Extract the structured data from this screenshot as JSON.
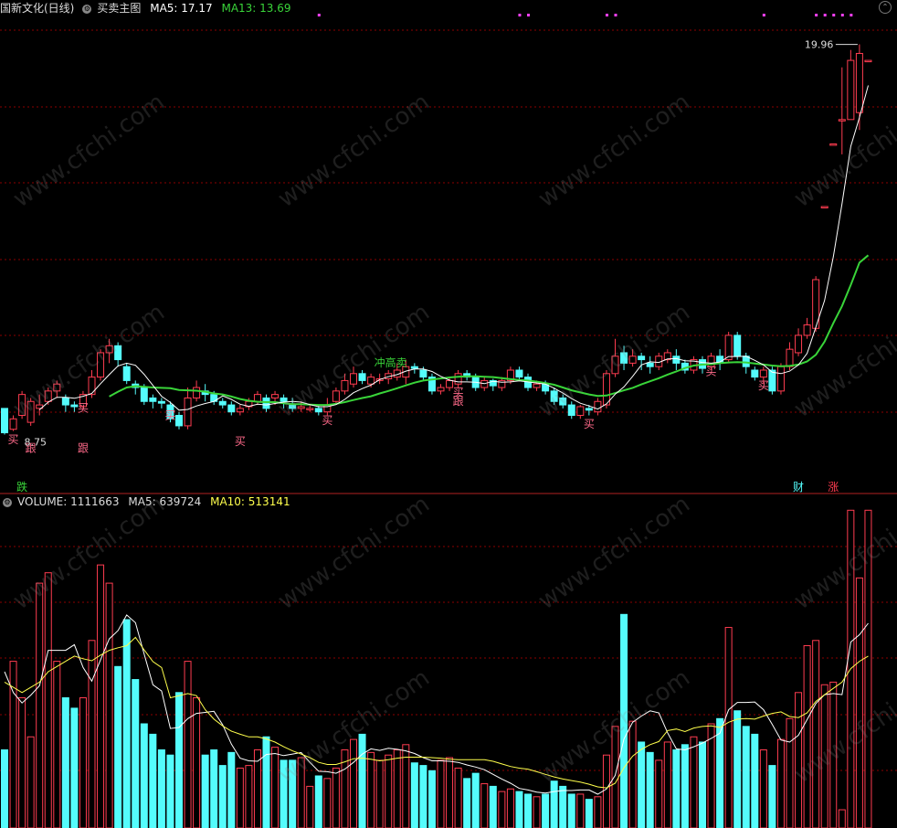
{
  "price_header": {
    "stock_name": "国新文化(日线)",
    "indicator_name": "买卖主图",
    "ma5_label": "MA5: 17.17",
    "ma13_label": "MA13: 13.69"
  },
  "volume_header": {
    "volume_label": "VOLUME: 1111663",
    "ma5_label": "MA5: 639724",
    "ma10_label": "MA10: 513141"
  },
  "watermark": "www.cfchi.com",
  "colors": {
    "up": "#ff3c50",
    "down": "#54fcfc",
    "ma5": "#ffffff",
    "ma13": "#39d439",
    "vol_ma10": "#ffff4c",
    "grid": "#8b0000"
  },
  "chart_data": {
    "type": "candlestick",
    "n": 100,
    "price_axis_range": [
      8.0,
      20.5
    ],
    "annotations": {
      "high_label": "19.96",
      "low_label": "8.75",
      "signals": [
        {
          "i": 1,
          "text": "买",
          "color": "#ff6a8a",
          "price": 8.5
        },
        {
          "i": 3,
          "text": "跟",
          "color": "#ff6a8a",
          "price": 8.25
        },
        {
          "i": 9,
          "text": "买",
          "color": "#ff6a8a",
          "price": 9.4
        },
        {
          "i": 9,
          "text": "跟",
          "color": "#ff6a8a",
          "price": 8.25
        },
        {
          "i": 19,
          "text": "买",
          "color": "#ff6a8a",
          "price": 9.2
        },
        {
          "i": 27,
          "text": "买",
          "color": "#ff6a8a",
          "price": 8.45
        },
        {
          "i": 37,
          "text": "买",
          "color": "#ff6a8a",
          "price": 9.05
        },
        {
          "i": 43,
          "text": "冲高卖",
          "color": "#39d439",
          "price": 10.7
        },
        {
          "i": 52,
          "text": "买",
          "color": "#ff6a8a",
          "price": 9.85
        },
        {
          "i": 52,
          "text": "跟",
          "color": "#ff6a8a",
          "price": 9.6
        },
        {
          "i": 67,
          "text": "买",
          "color": "#ff6a8a",
          "price": 8.95
        },
        {
          "i": 81,
          "text": "买",
          "color": "#ff6a8a",
          "price": 10.45
        },
        {
          "i": 87,
          "text": "买",
          "color": "#ff6a8a",
          "price": 10.05
        }
      ],
      "bottom_badges": [
        {
          "i": 2,
          "text": "跌",
          "color": "#39d439"
        },
        {
          "i": 91,
          "text": "财",
          "color": "#54fcfc"
        },
        {
          "i": 95,
          "text": "涨",
          "color": "#ff3c50"
        }
      ],
      "top_marks": [
        36,
        59,
        60,
        69,
        70,
        87,
        93,
        94,
        95,
        96,
        97
      ]
    },
    "candles": [
      [
        9.5,
        8.8,
        9.3,
        8.75
      ],
      [
        8.9,
        9.2,
        9.3,
        8.85
      ],
      [
        9.3,
        9.9,
        10.0,
        9.2
      ],
      [
        9.1,
        9.7,
        9.8,
        9.0
      ],
      [
        9.5,
        9.6,
        9.9,
        9.3
      ],
      [
        9.7,
        10.0,
        10.1,
        9.6
      ],
      [
        10.0,
        10.2,
        10.3,
        9.8
      ],
      [
        9.8,
        9.6,
        9.9,
        9.4
      ],
      [
        9.6,
        9.55,
        9.7,
        9.4
      ],
      [
        9.55,
        9.9,
        10.0,
        9.5
      ],
      [
        9.9,
        10.4,
        10.6,
        9.8
      ],
      [
        10.4,
        11.1,
        11.2,
        10.3
      ],
      [
        11.1,
        11.3,
        11.5,
        10.8
      ],
      [
        11.3,
        10.9,
        11.4,
        10.7
      ],
      [
        10.7,
        10.3,
        10.8,
        10.2
      ],
      [
        10.2,
        10.1,
        10.3,
        9.9
      ],
      [
        10.1,
        9.7,
        10.2,
        9.6
      ],
      [
        9.8,
        9.7,
        9.9,
        9.5
      ],
      [
        9.7,
        9.65,
        9.8,
        9.5
      ],
      [
        9.6,
        9.2,
        9.7,
        9.1
      ],
      [
        9.3,
        9.0,
        9.4,
        8.9
      ],
      [
        9.0,
        9.8,
        10.1,
        8.9
      ],
      [
        9.8,
        10.1,
        10.3,
        9.7
      ],
      [
        10.0,
        9.9,
        10.2,
        9.7
      ],
      [
        9.9,
        9.7,
        10.0,
        9.6
      ],
      [
        9.7,
        9.6,
        9.8,
        9.5
      ],
      [
        9.6,
        9.4,
        9.7,
        9.3
      ],
      [
        9.4,
        9.5,
        9.6,
        9.3
      ],
      [
        9.55,
        9.7,
        9.8,
        9.45
      ],
      [
        9.7,
        9.9,
        10.0,
        9.6
      ],
      [
        9.8,
        9.5,
        9.9,
        9.4
      ],
      [
        9.8,
        9.9,
        10.0,
        9.6
      ],
      [
        9.8,
        9.7,
        9.9,
        9.5
      ],
      [
        9.6,
        9.5,
        9.8,
        9.4
      ],
      [
        9.5,
        9.55,
        9.7,
        9.4
      ],
      [
        9.5,
        9.5,
        9.6,
        9.4
      ],
      [
        9.5,
        9.4,
        9.6,
        9.3
      ],
      [
        9.4,
        9.6,
        9.8,
        9.3
      ],
      [
        9.7,
        10.0,
        10.1,
        9.6
      ],
      [
        10.0,
        10.3,
        10.5,
        9.9
      ],
      [
        10.2,
        10.5,
        10.7,
        10.1
      ],
      [
        10.5,
        10.3,
        10.6,
        10.2
      ],
      [
        10.2,
        10.4,
        10.5,
        10.1
      ],
      [
        10.3,
        10.35,
        10.5,
        10.2
      ],
      [
        10.35,
        10.5,
        10.6,
        10.2
      ],
      [
        10.4,
        10.6,
        10.8,
        10.3
      ],
      [
        10.4,
        10.7,
        10.9,
        10.2
      ],
      [
        10.7,
        10.65,
        10.8,
        10.5
      ],
      [
        10.6,
        10.4,
        10.7,
        10.3
      ],
      [
        10.4,
        10.0,
        10.5,
        9.9
      ],
      [
        10.0,
        10.1,
        10.2,
        9.9
      ],
      [
        10.1,
        10.3,
        10.4,
        10.0
      ],
      [
        10.2,
        10.5,
        10.6,
        10.1
      ],
      [
        10.5,
        10.4,
        10.6,
        10.3
      ],
      [
        10.4,
        10.1,
        10.5,
        10.0
      ],
      [
        10.1,
        10.3,
        10.4,
        10.0
      ],
      [
        10.3,
        10.15,
        10.35,
        10.0
      ],
      [
        10.1,
        10.3,
        10.4,
        10.0
      ],
      [
        10.3,
        10.6,
        10.7,
        10.2
      ],
      [
        10.6,
        10.4,
        10.7,
        10.3
      ],
      [
        10.4,
        10.1,
        10.5,
        10.0
      ],
      [
        10.1,
        10.2,
        10.3,
        10.0
      ],
      [
        10.2,
        10.0,
        10.3,
        9.9
      ],
      [
        10.0,
        9.7,
        10.1,
        9.6
      ],
      [
        9.8,
        9.6,
        9.9,
        9.5
      ],
      [
        9.6,
        9.3,
        9.7,
        9.2
      ],
      [
        9.3,
        9.55,
        9.6,
        9.2
      ],
      [
        9.5,
        9.45,
        9.6,
        9.3
      ],
      [
        9.4,
        9.7,
        9.8,
        9.3
      ],
      [
        9.6,
        10.5,
        10.6,
        9.5
      ],
      [
        10.5,
        11.0,
        11.5,
        10.4
      ],
      [
        11.1,
        10.8,
        11.3,
        10.6
      ],
      [
        10.8,
        11.0,
        11.2,
        10.7
      ],
      [
        11.0,
        10.9,
        11.1,
        10.6
      ],
      [
        10.8,
        10.7,
        11.0,
        10.5
      ],
      [
        10.7,
        11.0,
        11.1,
        10.6
      ],
      [
        10.9,
        11.1,
        11.2,
        10.8
      ],
      [
        11.0,
        10.8,
        11.2,
        10.6
      ],
      [
        10.8,
        10.6,
        10.9,
        10.5
      ],
      [
        10.6,
        10.9,
        11.0,
        10.5
      ],
      [
        10.9,
        10.65,
        11.0,
        10.5
      ],
      [
        10.7,
        11.0,
        11.1,
        10.6
      ],
      [
        11.0,
        10.8,
        11.2,
        10.6
      ],
      [
        10.9,
        11.6,
        11.7,
        10.8
      ],
      [
        11.6,
        11.0,
        11.7,
        10.9
      ],
      [
        11.0,
        10.7,
        11.1,
        10.5
      ],
      [
        10.6,
        10.4,
        10.7,
        10.3
      ],
      [
        10.4,
        10.6,
        10.7,
        10.2
      ],
      [
        10.6,
        10.0,
        10.7,
        9.9
      ],
      [
        10.0,
        10.7,
        10.8,
        9.9
      ],
      [
        10.7,
        11.2,
        11.4,
        10.6
      ],
      [
        11.1,
        11.6,
        11.8,
        11.0
      ],
      [
        11.6,
        11.9,
        12.1,
        11.5
      ],
      [
        11.8,
        13.2,
        13.3,
        11.7
      ],
      [
        15.3,
        15.3,
        15.3,
        15.3
      ],
      [
        17.1,
        17.1,
        17.1,
        17.1
      ],
      [
        17.8,
        17.8,
        19.3,
        16.8
      ],
      [
        17.8,
        19.5,
        19.8,
        17.8
      ],
      [
        18.0,
        19.7,
        19.96,
        17.5
      ],
      [
        19.5,
        19.5,
        19.5,
        19.5
      ]
    ],
    "ma5": [
      null,
      null,
      null,
      null,
      9.46,
      9.68,
      9.82,
      9.82,
      9.79,
      9.85,
      9.93,
      10.21,
      10.47,
      10.72,
      10.8,
      10.74,
      10.48,
      10.16,
      9.85,
      9.67,
      9.45,
      9.47,
      9.57,
      9.64,
      9.7,
      9.86,
      9.76,
      9.62,
      9.56,
      9.62,
      9.6,
      9.64,
      9.68,
      9.7,
      9.68,
      9.61,
      9.55,
      9.55,
      9.61,
      9.76,
      9.95,
      10.07,
      10.17,
      10.33,
      10.41,
      10.47,
      10.57,
      10.63,
      10.63,
      10.56,
      10.42,
      10.31,
      10.26,
      10.26,
      10.25,
      10.21,
      10.28,
      10.25,
      10.26,
      10.29,
      10.26,
      10.23,
      10.2,
      10.08,
      9.94,
      9.78,
      9.65,
      9.57,
      9.48,
      9.63,
      9.91,
      10.12,
      10.42,
      10.75,
      10.84,
      10.82,
      10.92,
      10.93,
      10.87,
      10.86,
      10.82,
      10.8,
      10.83,
      10.99,
      10.99,
      11.0,
      10.88,
      10.75,
      10.54,
      10.5,
      10.57,
      10.75,
      11.08,
      11.84,
      12.6,
      13.86,
      15.38,
      17.03,
      17.86,
      18.78
    ],
    "ma13": [
      null,
      null,
      null,
      null,
      null,
      null,
      null,
      null,
      null,
      null,
      null,
      null,
      9.84,
      9.98,
      10.1,
      10.14,
      10.12,
      10.1,
      10.09,
      10.08,
      10.03,
      10.02,
      10.01,
      9.98,
      9.93,
      9.9,
      9.84,
      9.77,
      9.72,
      9.69,
      9.68,
      9.68,
      9.65,
      9.62,
      9.62,
      9.61,
      9.6,
      9.6,
      9.63,
      9.68,
      9.74,
      9.8,
      9.85,
      9.93,
      10.0,
      10.08,
      10.16,
      10.24,
      10.3,
      10.33,
      10.36,
      10.39,
      10.41,
      10.42,
      10.42,
      10.41,
      10.4,
      10.37,
      10.34,
      10.32,
      10.3,
      10.27,
      10.23,
      10.18,
      10.1,
      10.02,
      9.96,
      9.9,
      9.86,
      9.87,
      9.94,
      10.02,
      10.09,
      10.19,
      10.28,
      10.37,
      10.47,
      10.56,
      10.66,
      10.73,
      10.76,
      10.77,
      10.8,
      10.82,
      10.83,
      10.82,
      10.79,
      10.76,
      10.73,
      10.71,
      10.72,
      10.76,
      10.85,
      11.04,
      11.42,
      11.95,
      12.44,
      13.05,
      13.69,
      13.9
    ],
    "volume_axis_max": 1200000,
    "volume": [
      300,
      640,
      500,
      350,
      940,
      980,
      640,
      500,
      460,
      500,
      720,
      1010,
      940,
      620,
      800,
      570,
      400,
      360,
      300,
      280,
      520,
      640,
      500,
      280,
      300,
      240,
      290,
      230,
      240,
      300,
      350,
      310,
      260,
      260,
      270,
      160,
      200,
      190,
      230,
      300,
      340,
      360,
      290,
      260,
      280,
      300,
      320,
      250,
      240,
      220,
      260,
      270,
      230,
      190,
      210,
      170,
      160,
      140,
      150,
      140,
      130,
      120,
      130,
      180,
      160,
      130,
      130,
      110,
      120,
      280,
      390,
      820,
      410,
      330,
      290,
      260,
      330,
      300,
      320,
      350,
      330,
      400,
      420,
      770,
      450,
      390,
      360,
      300,
      240,
      340,
      420,
      520,
      700,
      720,
      550,
      560,
      70,
      1220,
      960,
      1220
    ],
    "vol_ma5": [
      600,
      520,
      480,
      510,
      546,
      682,
      682,
      682,
      704,
      616,
      564,
      646,
      726,
      758,
      818,
      788,
      668,
      550,
      526,
      382,
      386,
      420,
      440,
      444,
      448,
      396,
      322,
      268,
      258,
      256,
      282,
      286,
      278,
      284,
      290,
      252,
      218,
      216,
      210,
      226,
      252,
      284,
      304,
      298,
      306,
      302,
      296,
      286,
      270,
      258,
      258,
      256,
      252,
      242,
      234,
      224,
      206,
      188,
      172,
      152,
      146,
      138,
      134,
      140,
      144,
      144,
      146,
      146,
      130,
      150,
      202,
      342,
      406,
      430,
      450,
      442,
      366,
      304,
      300,
      312,
      326,
      344,
      364,
      454,
      482,
      482,
      484,
      454,
      398,
      338,
      330,
      356,
      416,
      478,
      512,
      516,
      512,
      714,
      742,
      786
    ],
    "vol_ma10": [
      560,
      540,
      520,
      540,
      560,
      600,
      620,
      640,
      660,
      650,
      642,
      664,
      682,
      692,
      700,
      732,
      684,
      639,
      616,
      500,
      508,
      516,
      508,
      454,
      418,
      392,
      372,
      360,
      350,
      350,
      342,
      330,
      312,
      296,
      284,
      270,
      252,
      244,
      244,
      254,
      266,
      268,
      264,
      258,
      262,
      268,
      272,
      272,
      272,
      270,
      268,
      264,
      262,
      262,
      262,
      262,
      256,
      246,
      236,
      230,
      226,
      216,
      206,
      196,
      188,
      182,
      176,
      168,
      158,
      154,
      172,
      232,
      276,
      302,
      320,
      332,
      374,
      380,
      370,
      384,
      390,
      392,
      386,
      406,
      418,
      420,
      418,
      430,
      440,
      446,
      428,
      424,
      442,
      486,
      512,
      536,
      560,
      612,
      640,
      660
    ]
  }
}
